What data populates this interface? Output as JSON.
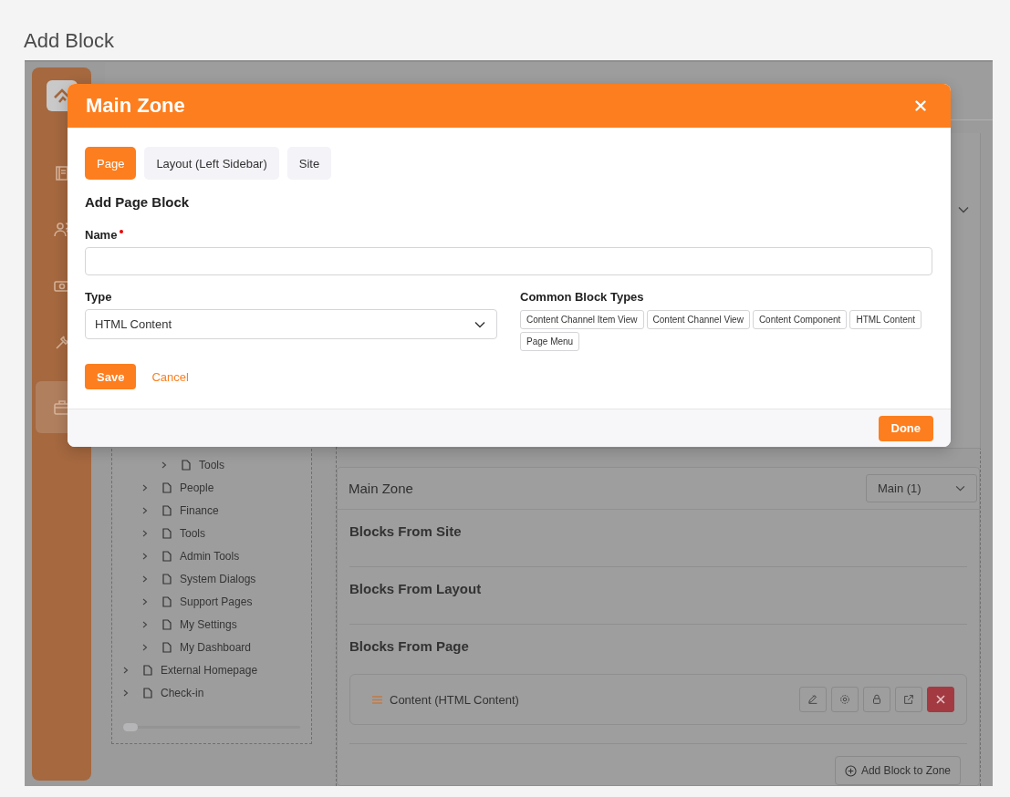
{
  "title": "Add Block",
  "app": {
    "sidebar": {
      "items": [
        {
          "selected": false
        },
        {
          "selected": false
        },
        {
          "selected": false
        },
        {
          "selected": false
        },
        {
          "selected": true
        }
      ]
    },
    "tree": [
      {
        "children": [
          {
            "children": [
              {
                "label": "Tools"
              }
            ]
          },
          {
            "label": "People"
          },
          {
            "label": "Finance"
          },
          {
            "label": "Tools"
          },
          {
            "label": "Admin Tools"
          },
          {
            "label": "System Dialogs"
          },
          {
            "label": "Support Pages"
          },
          {
            "label": "My Settings"
          },
          {
            "label": "My Dashboard"
          }
        ]
      },
      {
        "label": "External Homepage"
      },
      {
        "label": "Check-in"
      }
    ],
    "zone": {
      "title": "Main Zone",
      "select": "Main (1)"
    },
    "sections": [
      {
        "title": "Blocks From Site"
      },
      {
        "title": "Blocks From Layout"
      },
      {
        "title": "Blocks From Page",
        "blocks": [
          {
            "name": "Content (HTML Content)"
          }
        ]
      }
    ],
    "add_button": "Add Block to Zone"
  },
  "modal": {
    "title": "Main Zone",
    "tabs": [
      {
        "label": "Page",
        "selected": true
      },
      {
        "label": "Layout (Left Sidebar)",
        "selected": false
      },
      {
        "label": "Site",
        "selected": false
      }
    ],
    "heading": "Add Page Block",
    "name_field": {
      "label": "Name",
      "required": true
    },
    "type_field": {
      "label": "Type",
      "value": "HTML Content"
    },
    "common": {
      "label": "Common Block Types",
      "items": [
        "Content Channel Item View",
        "Content Channel View",
        "Content Component",
        "HTML Content",
        "Page Menu"
      ]
    },
    "save": "Save",
    "cancel": "Cancel",
    "done": "Done"
  }
}
